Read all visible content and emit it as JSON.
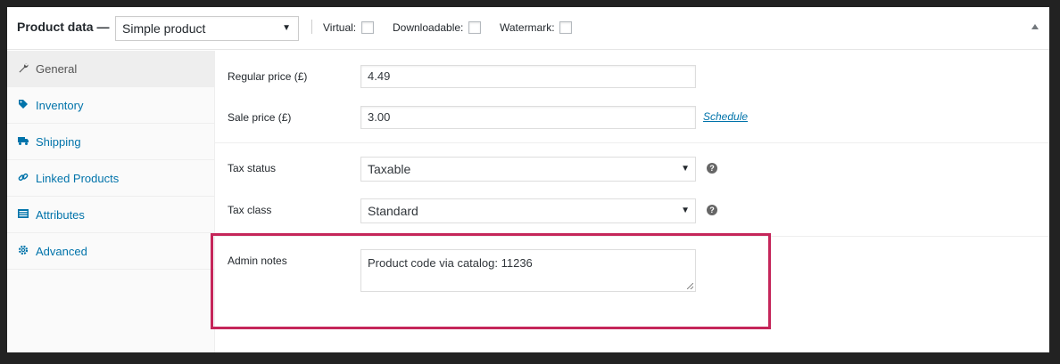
{
  "header": {
    "title": "Product data —",
    "product_type": "Simple product",
    "virtual_label": "Virtual:",
    "downloadable_label": "Downloadable:",
    "watermark_label": "Watermark:"
  },
  "tabs": [
    {
      "label": "General",
      "icon": "wrench-icon",
      "active": true
    },
    {
      "label": "Inventory",
      "icon": "tag-icon"
    },
    {
      "label": "Shipping",
      "icon": "truck-icon"
    },
    {
      "label": "Linked Products",
      "icon": "link-icon"
    },
    {
      "label": "Attributes",
      "icon": "list-icon"
    },
    {
      "label": "Advanced",
      "icon": "gear-icon"
    }
  ],
  "general": {
    "regular_price_label": "Regular price (£)",
    "regular_price": "4.49",
    "sale_price_label": "Sale price (£)",
    "sale_price": "3.00",
    "schedule_link": "Schedule",
    "tax_status_label": "Tax status",
    "tax_status": "Taxable",
    "tax_class_label": "Tax class",
    "tax_class": "Standard",
    "admin_notes_label": "Admin notes",
    "admin_notes": "Product code via catalog: 11236"
  },
  "colors": {
    "link": "#0073aa",
    "highlight": "#c5265a"
  }
}
